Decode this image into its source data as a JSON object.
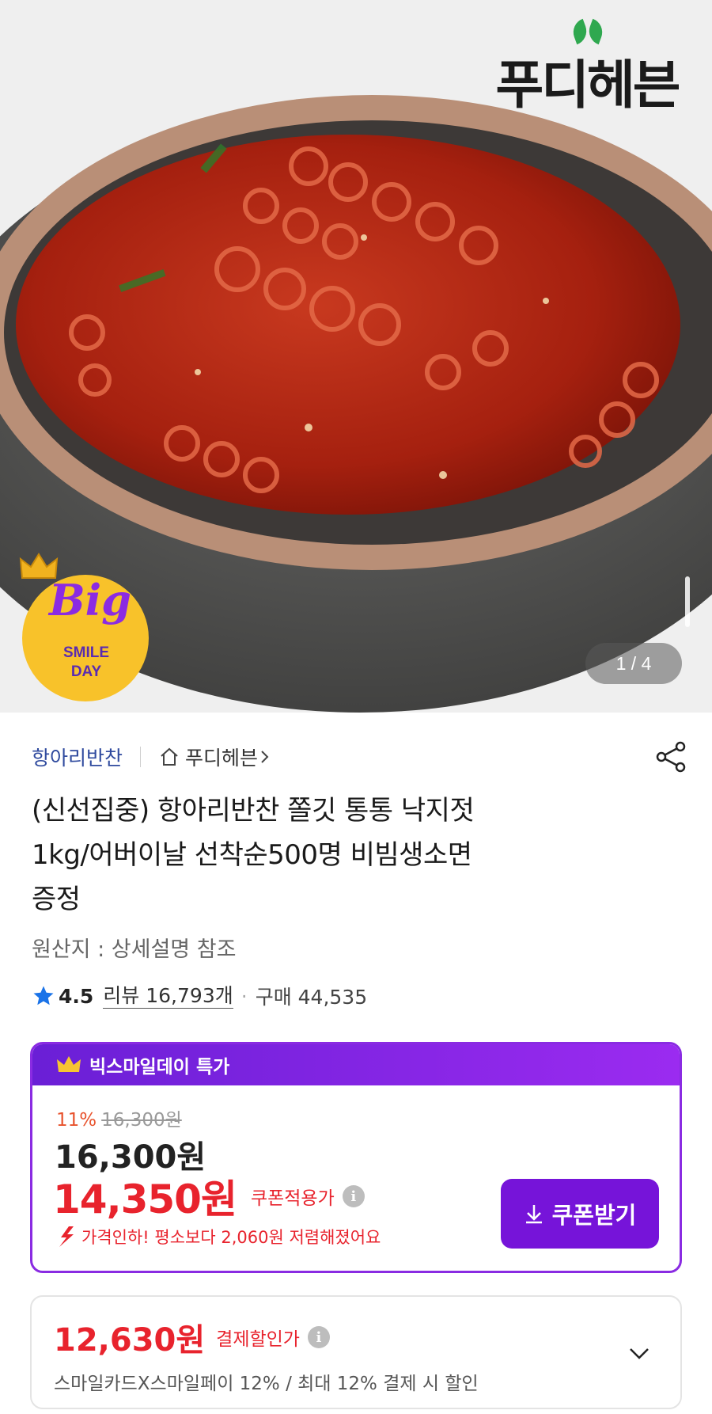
{
  "hero": {
    "brand_logo_text": "푸디헤븐",
    "badge": {
      "word": "Big",
      "line1": "SMILE",
      "line2": "DAY"
    },
    "counter": "1 / 4"
  },
  "product": {
    "category": "항아리반찬",
    "store": "푸디헤븐",
    "title_line1": "(신선집중) 항아리반찬 쫄깃 통통 낙지젓",
    "title_line2": "1kg/어버이날 선착순500명 비빔생소면",
    "title_line3": "증정",
    "origin": "원산지 : 상세설명 참조",
    "rating": "4.5",
    "review": "리뷰 16,793개",
    "purchase": "구매 44,535"
  },
  "deal": {
    "header": "빅스마일데이 특가",
    "discount_pct": "11%",
    "original_price": "16,300원",
    "price": "16,300원",
    "coupon_price": "14,350원",
    "coupon_label": "쿠폰적용가",
    "drop_text": "가격인하! 평소보다 2,060원 저렴해졌어요",
    "coupon_button": "쿠폰받기"
  },
  "pay": {
    "price": "12,630원",
    "label": "결제할인가",
    "sub": "스마일카드X스마일페이 12% / 최대 12% 결제 시 할인"
  },
  "colors": {
    "accent_purple": "#7614d9",
    "sale_red": "#e8232d",
    "category_blue": "#2f4a9e"
  }
}
